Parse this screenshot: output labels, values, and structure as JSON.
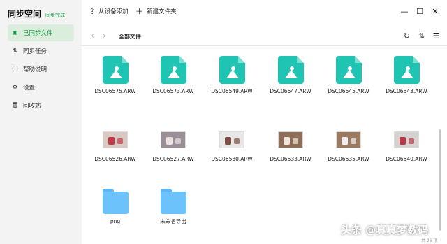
{
  "app": {
    "title": "同步空间",
    "sync_status": "同步完成"
  },
  "sidebar": {
    "items": [
      {
        "label": "已同步文件",
        "icon": "file-icon",
        "glyph": "▣",
        "active": true
      },
      {
        "label": "同步任务",
        "icon": "sync-arrows-icon",
        "glyph": "⇅",
        "active": false
      },
      {
        "label": "帮助说明",
        "icon": "info-icon",
        "glyph": "ⓘ",
        "active": false
      },
      {
        "label": "设置",
        "icon": "gear-icon",
        "glyph": "⚙",
        "active": false
      },
      {
        "label": "回收站",
        "icon": "trash-icon",
        "glyph": "🗑",
        "active": false
      }
    ]
  },
  "toolbar": {
    "add_from_device": "从设备添加",
    "new_folder": "新建文件夹"
  },
  "pathbar": {
    "current": "全部文件"
  },
  "files": [
    {
      "name": "DSC06575.ARW",
      "kind": "image"
    },
    {
      "name": "DSC06573.ARW",
      "kind": "image"
    },
    {
      "name": "DSC06549.ARW",
      "kind": "image"
    },
    {
      "name": "DSC06547.ARW",
      "kind": "image"
    },
    {
      "name": "DSC06545.ARW",
      "kind": "image"
    },
    {
      "name": "DSC06543.ARW",
      "kind": "image"
    },
    {
      "name": "DSC06526.ARW",
      "kind": "thumb",
      "bg": "#d9c9c2",
      "fg": "#c23a4a"
    },
    {
      "name": "DSC06527.ARW",
      "kind": "thumb",
      "bg": "#9a8f96",
      "fg": "#e8e2e0"
    },
    {
      "name": "DSC06530.ARW",
      "kind": "thumb",
      "bg": "#e9e7e6",
      "fg": "#7b5046"
    },
    {
      "name": "DSC06533.ARW",
      "kind": "thumb",
      "bg": "#8e6e58",
      "fg": "#f0e6dc"
    },
    {
      "name": "DSC06535.ARW",
      "kind": "thumb",
      "bg": "#9c7a62",
      "fg": "#f2eef0"
    },
    {
      "name": "DSC06540.ARW",
      "kind": "thumb",
      "bg": "#d6d2d0",
      "fg": "#b83a4a"
    },
    {
      "name": "png",
      "kind": "folder"
    },
    {
      "name": "未命名导出",
      "kind": "folder"
    }
  ],
  "watermark": "头条 @真真梦数码",
  "item_count": "共 26 项",
  "colors": {
    "accent": "#14943f",
    "image_icon": "#20c4b3",
    "folder": "#6cc3fb"
  }
}
